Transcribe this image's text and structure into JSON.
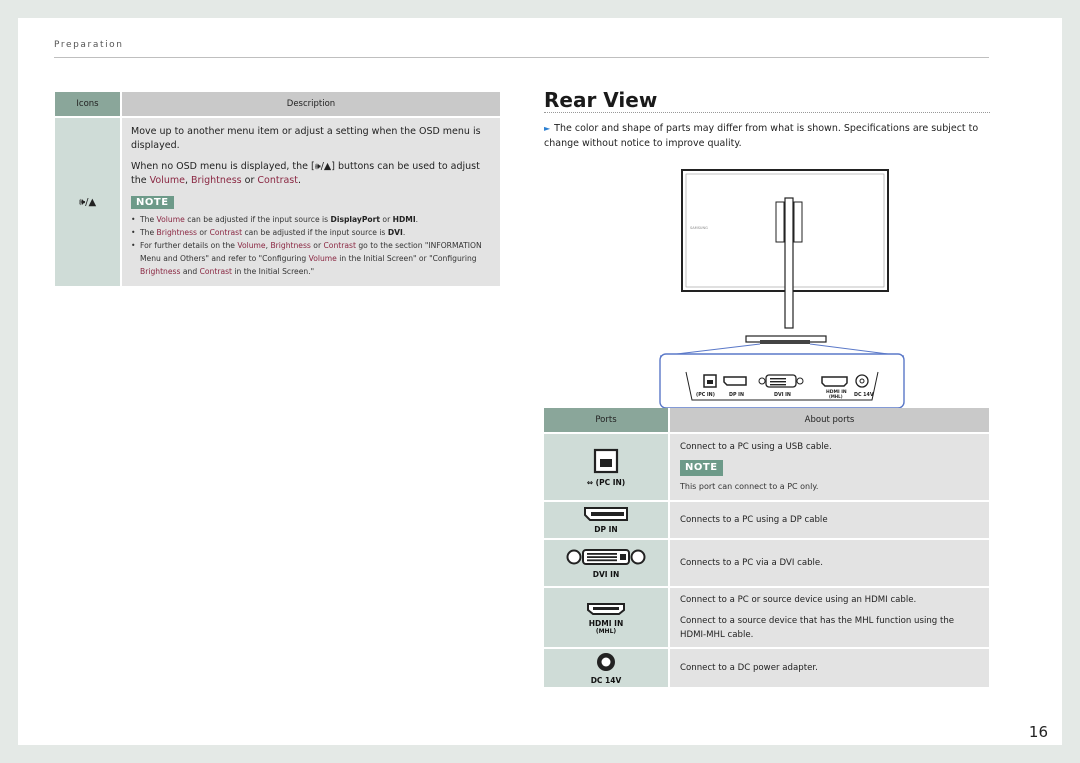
{
  "header": {
    "section": "Preparation"
  },
  "page_number": "16",
  "icons_table": {
    "col_icons": "Icons",
    "col_description": "Description",
    "row": {
      "icon_label": "🕪/▲",
      "para1": "Move up to another menu item or adjust a setting when the OSD menu is displayed.",
      "para2_pre": "When no OSD menu is displayed, the [🕪/▲] buttons can be used to adjust the ",
      "volume": "Volume",
      "comma": ", ",
      "brightness": "Brightness",
      "or": " or ",
      "contrast": "Contrast",
      "period": ".",
      "note_label": "NOTE",
      "bullet1": {
        "pre": "The ",
        "hl": "Volume",
        "mid": " can be adjusted if the input source is ",
        "b1": "DisplayPort",
        "or": " or ",
        "b2": "HDMI",
        "end": "."
      },
      "bullet2": {
        "pre": "The ",
        "hl1": "Brightness",
        "or": " or ",
        "hl2": "Contrast",
        "mid": " can be adjusted if the input source is ",
        "b": "DVI",
        "end": "."
      },
      "bullet3": {
        "p1": "For further details on the ",
        "hl1": "Volume",
        "c1": ", ",
        "hl2": "Brightness",
        "or": " or ",
        "hl3": "Contrast",
        "p2": " go to the section \"INFORMATION Menu and Others\" and refer to \"Configuring ",
        "hl4": "Volume",
        "p3": " in the Initial Screen\" or \"Configuring ",
        "hl5": "Brightness",
        "and": " and ",
        "hl6": "Contrast",
        "p4": " in the Initial Screen.\""
      }
    }
  },
  "rear_view": {
    "title": "Rear View",
    "intro": "The color and shape of parts may differ from what is shown. Specifications are subject to change without notice to improve quality.",
    "diagram_labels": {
      "pc_in": "(PC IN)",
      "dp_in": "DP IN",
      "dvi_in": "DVI IN",
      "hdmi_in": "HDMI IN",
      "mhl": "(MHL)",
      "dc": "DC 14V"
    }
  },
  "ports_table": {
    "col_ports": "Ports",
    "col_about": "About ports",
    "rows": [
      {
        "caption": "(PC IN)",
        "line1": "Connect to a PC using a USB cable.",
        "note_label": "NOTE",
        "note": "This port can connect to a PC only."
      },
      {
        "caption": "DP IN",
        "line1": "Connects to a PC using a DP cable"
      },
      {
        "caption": "DVI IN",
        "line1": "Connects to a PC via a DVI cable."
      },
      {
        "caption": "HDMI IN",
        "sub": "(MHL)",
        "line1": "Connect to a PC or source device using an HDMI cable.",
        "line2": "Connect to a source device that has the MHL function using the HDMI-MHL cable."
      },
      {
        "caption": "DC 14V",
        "line1": "Connect to a DC power adapter."
      }
    ]
  },
  "colors": {
    "header_green": "#8aa69a",
    "cell_green": "#cfdcd7",
    "accent_text": "#8a2742",
    "note_badge": "#6d9a89"
  }
}
